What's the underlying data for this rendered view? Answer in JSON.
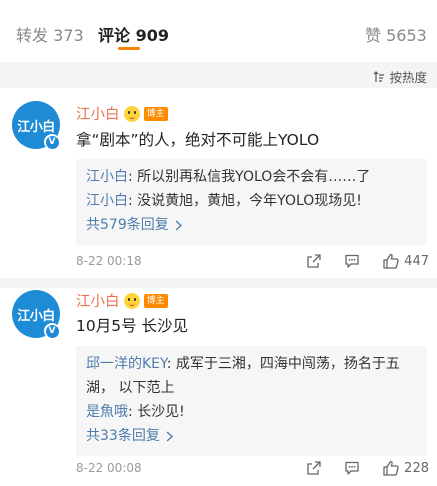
{
  "tabs": [
    {
      "label": "转发",
      "count": "373"
    },
    {
      "label": "评论",
      "count": "909"
    },
    {
      "label": "赞",
      "count": "5653"
    }
  ],
  "colors": {
    "accent": "#ff8200",
    "username": "#eb7350",
    "link": "#4f7cae",
    "avatar": "#1d8bd6"
  },
  "sort_label": "按热度",
  "comments": [
    {
      "avatar_text": "江小白",
      "username": "江小白",
      "role_tag": "博主",
      "text": "拿“剧本”的人，绝对不可能上YOLO",
      "replies": [
        {
          "author": "江小白",
          "sep": ": ",
          "text": "所以别再私信我YOLO会不会有……了"
        },
        {
          "author": "江小白",
          "sep": ": ",
          "text": "没说黄旭，黄旭，今年YOLO现场见!"
        }
      ],
      "more_replies": "共579条回复",
      "timestamp": "8-22 00:18",
      "likes": "447"
    },
    {
      "avatar_text": "江小白",
      "username": "江小白",
      "role_tag": "博主",
      "text": "10月5号 长沙见",
      "replies": [
        {
          "author": "邱一洋的KEY",
          "sep": ": ",
          "text": "成军于三湘，四海中闯荡，扬名于五湖， 以下范上"
        },
        {
          "author": "是魚哦",
          "sep": ": ",
          "text": "长沙见!"
        }
      ],
      "more_replies": "共33条回复",
      "timestamp": "8-22 00:08",
      "likes": "228"
    }
  ]
}
